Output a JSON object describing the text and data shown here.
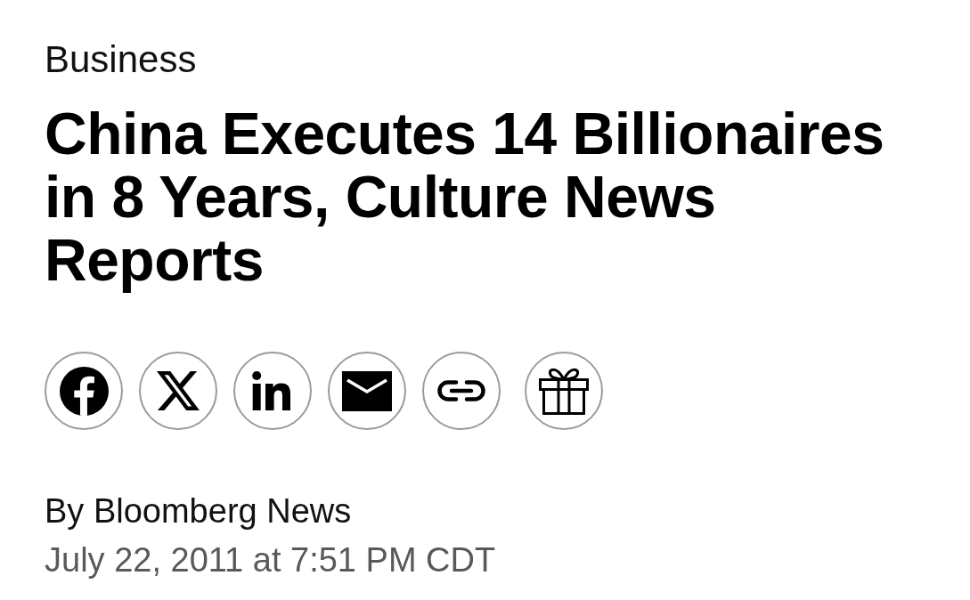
{
  "section": "Business",
  "headline": "China Executes 14 Billionaires in 8 Years, Culture News Reports",
  "byline": "By Bloomberg News",
  "timestamp": "July 22, 2011 at 7:51 PM CDT"
}
